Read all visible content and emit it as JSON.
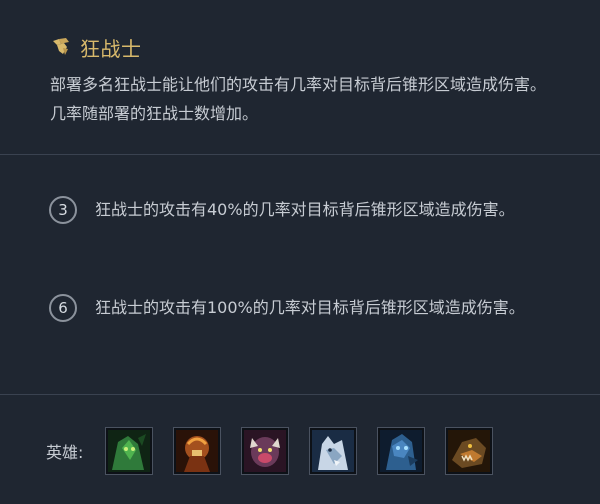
{
  "trait": {
    "title": "狂战士",
    "icon": "berserker-trait-icon",
    "title_color": "#d8b96b",
    "description": "部署多名狂战士能让他们的攻击有几率对目标背后锥形区域造成伤害。几率随部署的狂战士数增加。"
  },
  "tiers": [
    {
      "count": "3",
      "text": "狂战士的攻击有40%的几率对目标背后锥形区域造成伤害。"
    },
    {
      "count": "6",
      "text": "狂战士的攻击有100%的几率对目标背后锥形区域造成伤害。"
    }
  ],
  "heroes": {
    "label": "英雄:",
    "portraits": [
      {
        "icon": "hero-portrait-green-icon",
        "color": "#2f7a3a"
      },
      {
        "icon": "hero-portrait-orange-icon",
        "color": "#a4501e"
      },
      {
        "icon": "hero-portrait-purple-icon",
        "color": "#6a3a5a"
      },
      {
        "icon": "hero-portrait-wolf-icon",
        "color": "#6f8aa8"
      },
      {
        "icon": "hero-portrait-blue-icon",
        "color": "#2d5f8f"
      },
      {
        "icon": "hero-portrait-dragon-icon",
        "color": "#6b4a22"
      }
    ]
  }
}
